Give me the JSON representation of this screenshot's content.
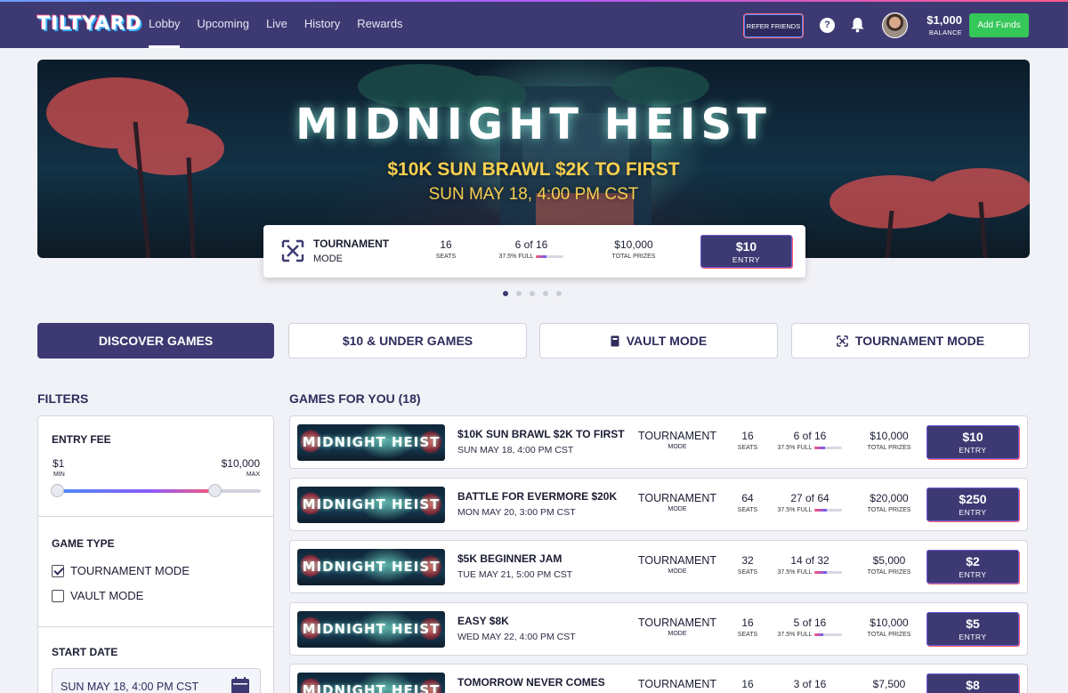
{
  "header": {
    "logo": "TILTYARD",
    "nav": [
      "Lobby",
      "Upcoming",
      "Live",
      "History",
      "Rewards"
    ],
    "refer_label": "REFER FRIENDS",
    "help_icon": "question-circle-icon",
    "bell_icon": "bell-icon",
    "balance_amount": "$1,000",
    "balance_label": "BALANCE",
    "add_funds_label": "Add Funds"
  },
  "hero": {
    "title": "MIDNIGHT HEIST",
    "subtitle": "$10K SUN BRAWL $2K TO FIRST",
    "date": "SUN MAY 18, 4:00 PM CST",
    "card": {
      "mode_line1": "TOURNAMENT",
      "mode_line2": "MODE",
      "seats_value": "16",
      "seats_label": "SEATS",
      "fill_value": "6 of 16",
      "fill_label": "37.5% FULL",
      "fill_fraction": 0.375,
      "prizes_value": "$10,000",
      "prizes_label": "TOTAL PRIZES",
      "entry_price": "$10",
      "entry_label": "ENTRY"
    },
    "carousel_count": 5,
    "carousel_active": 0
  },
  "categories": [
    {
      "label": "DISCOVER GAMES",
      "icon": ""
    },
    {
      "label": "$10 & UNDER GAMES",
      "icon": ""
    },
    {
      "label": "VAULT MODE",
      "icon": "vault-icon"
    },
    {
      "label": "TOURNAMENT MODE",
      "icon": "tournament-icon"
    }
  ],
  "filters": {
    "heading": "FILTERS",
    "entry_fee_label": "ENTRY FEE",
    "min_value": "$1",
    "min_label": "MIN",
    "max_value": "$10,000",
    "max_label": "MAX",
    "game_type_label": "GAME TYPE",
    "tournament_label": "TOURNAMENT MODE",
    "tournament_checked": true,
    "vault_label": "VAULT MODE",
    "vault_checked": false,
    "start_date_label": "START DATE",
    "start_date_value": "SUN MAY 18, 4:00 PM CST"
  },
  "games_heading": "GAMES FOR YOU (18)",
  "games": [
    {
      "thumb": "MIDNIGHT HEIST",
      "title": "$10K SUN BRAWL $2K TO FIRST",
      "date": "SUN MAY 18, 4:00 PM CST",
      "mode": "TOURNAMENT",
      "mode_label": "MODE",
      "seats": "16",
      "seats_label": "SEATS",
      "fill": "6 of 16",
      "fill_label": "37.5% FULL",
      "prizes": "$10,000",
      "prizes_label": "TOTAL PRIZES",
      "entry": "$10",
      "entry_label": "ENTRY"
    },
    {
      "thumb": "MIDNIGHT HEIST",
      "title": "BATTLE FOR EVERMORE $20K",
      "date": "MON MAY 20, 3:00 PM CST",
      "mode": "TOURNAMENT",
      "mode_label": "MODE",
      "seats": "64",
      "seats_label": "SEATS",
      "fill": "27 of 64",
      "fill_label": "37.5% FULL",
      "prizes": "$20,000",
      "prizes_label": "TOTAL PRIZES",
      "entry": "$250",
      "entry_label": "ENTRY"
    },
    {
      "thumb": "MIDNIGHT HEIST",
      "title": "$5K BEGINNER JAM",
      "date": "TUE MAY 21, 5:00 PM CST",
      "mode": "TOURNAMENT",
      "mode_label": "MODE",
      "seats": "32",
      "seats_label": "SEATS",
      "fill": "14 of 32",
      "fill_label": "37.5% FULL",
      "prizes": "$5,000",
      "prizes_label": "TOTAL PRIZES",
      "entry": "$2",
      "entry_label": "ENTRY"
    },
    {
      "thumb": "MIDNIGHT HEIST",
      "title": "EASY $8K",
      "date": "WED MAY 22, 4:00 PM CST",
      "mode": "TOURNAMENT",
      "mode_label": "MODE",
      "seats": "16",
      "seats_label": "SEATS",
      "fill": "5 of 16",
      "fill_label": "37.5% FULL",
      "prizes": "$10,000",
      "prizes_label": "TOTAL PRIZES",
      "entry": "$5",
      "entry_label": "ENTRY"
    },
    {
      "thumb": "MIDNIGHT HEIST",
      "title": "TOMORROW NEVER COMES",
      "date": "",
      "mode": "TOURNAMENT",
      "mode_label": "",
      "seats": "16",
      "seats_label": "",
      "fill": "3 of 16",
      "fill_label": "",
      "prizes": "$7,500",
      "prizes_label": "",
      "entry": "$8",
      "entry_label": ""
    }
  ]
}
